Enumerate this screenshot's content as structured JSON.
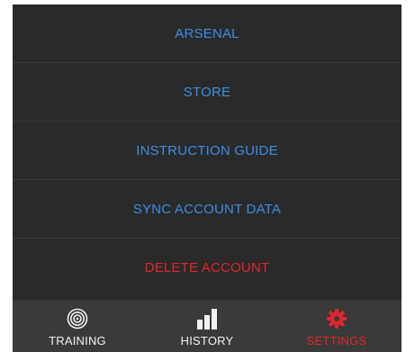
{
  "menu": {
    "items": [
      {
        "label": "ARSENAL"
      },
      {
        "label": "STORE"
      },
      {
        "label": "INSTRUCTION GUIDE"
      },
      {
        "label": "SYNC ACCOUNT DATA"
      },
      {
        "label": "DELETE ACCOUNT"
      }
    ]
  },
  "tabbar": {
    "tabs": [
      {
        "label": "TRAINING",
        "icon": "target-icon"
      },
      {
        "label": "HISTORY",
        "icon": "bar-chart-icon"
      },
      {
        "label": "SETTINGS",
        "icon": "gear-icon",
        "active": true
      }
    ]
  },
  "colors": {
    "background": "#2a2a2a",
    "link_blue": "#3d8ee6",
    "danger_red": "#e3262e",
    "tabbar": "#3a3a3a",
    "tab_text": "#f2f2f2",
    "active_tab": "#e3262e"
  }
}
